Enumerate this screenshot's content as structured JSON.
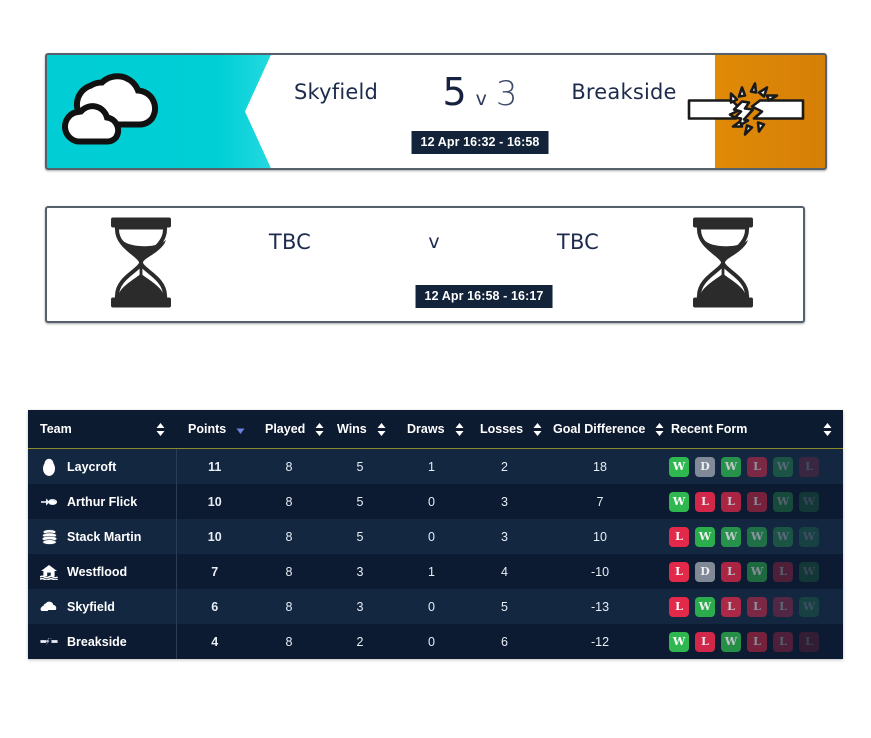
{
  "matches": [
    {
      "id": "match-played",
      "status": "played",
      "home_team": "Skyfield",
      "away_team": "Breakside",
      "home_score": "5",
      "away_score": "3",
      "vs_label": "v",
      "time_label": "12 Apr 16:32 - 16:58",
      "home_crest": "cloud-icon",
      "away_crest": "broken-bar-icon",
      "gradient_start": "#00cdd4",
      "gradient_end": "#d67f07"
    },
    {
      "id": "match-tbc",
      "status": "upcoming",
      "home_team": "TBC",
      "away_team": "TBC",
      "home_score": "",
      "away_score": "",
      "vs_label": "v",
      "time_label": "12 Apr 16:58 - 16:17",
      "home_crest": "hourglass-icon",
      "away_crest": "hourglass-icon",
      "gradient_start": "#ffffff",
      "gradient_end": "#ffffff"
    }
  ],
  "table": {
    "columns": [
      {
        "key": "team",
        "label": "Team",
        "sort": "none"
      },
      {
        "key": "points",
        "label": "Points",
        "sort": "desc"
      },
      {
        "key": "played",
        "label": "Played",
        "sort": "none"
      },
      {
        "key": "wins",
        "label": "Wins",
        "sort": "none"
      },
      {
        "key": "draws",
        "label": "Draws",
        "sort": "none"
      },
      {
        "key": "losses",
        "label": "Losses",
        "sort": "none"
      },
      {
        "key": "gd",
        "label": "Goal Difference",
        "sort": "none"
      },
      {
        "key": "form",
        "label": "Recent Form",
        "sort": "none"
      }
    ],
    "rows": [
      {
        "team": "Laycroft",
        "crest": "egg-icon",
        "points": "11",
        "played": "8",
        "wins": "5",
        "draws": "1",
        "losses": "2",
        "gd": "18",
        "form": [
          "W",
          "D",
          "W",
          "L",
          "W",
          "L"
        ]
      },
      {
        "team": "Arthur Flick",
        "crest": "flick-hand-icon",
        "points": "10",
        "played": "8",
        "wins": "5",
        "draws": "0",
        "losses": "3",
        "gd": "7",
        "form": [
          "W",
          "L",
          "L",
          "L",
          "W",
          "W"
        ]
      },
      {
        "team": "Stack Martin",
        "crest": "stack-icon",
        "points": "10",
        "played": "8",
        "wins": "5",
        "draws": "0",
        "losses": "3",
        "gd": "10",
        "form": [
          "L",
          "W",
          "W",
          "W",
          "W",
          "W"
        ]
      },
      {
        "team": "Westflood",
        "crest": "flooded-house-icon",
        "points": "7",
        "played": "8",
        "wins": "3",
        "draws": "1",
        "losses": "4",
        "gd": "-10",
        "form": [
          "L",
          "D",
          "L",
          "W",
          "L",
          "W"
        ]
      },
      {
        "team": "Skyfield",
        "crest": "cloud-icon",
        "points": "6",
        "played": "8",
        "wins": "3",
        "draws": "0",
        "losses": "5",
        "gd": "-13",
        "form": [
          "L",
          "W",
          "L",
          "L",
          "L",
          "W"
        ]
      },
      {
        "team": "Breakside",
        "crest": "broken-bar-icon",
        "points": "4",
        "played": "8",
        "wins": "2",
        "draws": "0",
        "losses": "6",
        "gd": "-12",
        "form": [
          "W",
          "L",
          "W",
          "L",
          "L",
          "L"
        ]
      }
    ]
  },
  "colors": {
    "table_bg": "#0d1b2f",
    "row_odd": "#132740",
    "row_even": "#0c1b31",
    "header_underline": "#8d8b26",
    "win": "#2eb84f",
    "loss": "#e2294a",
    "draw": "#8b93a0",
    "sort_active": "#6c7ee0",
    "chip_bg": "#132339"
  }
}
